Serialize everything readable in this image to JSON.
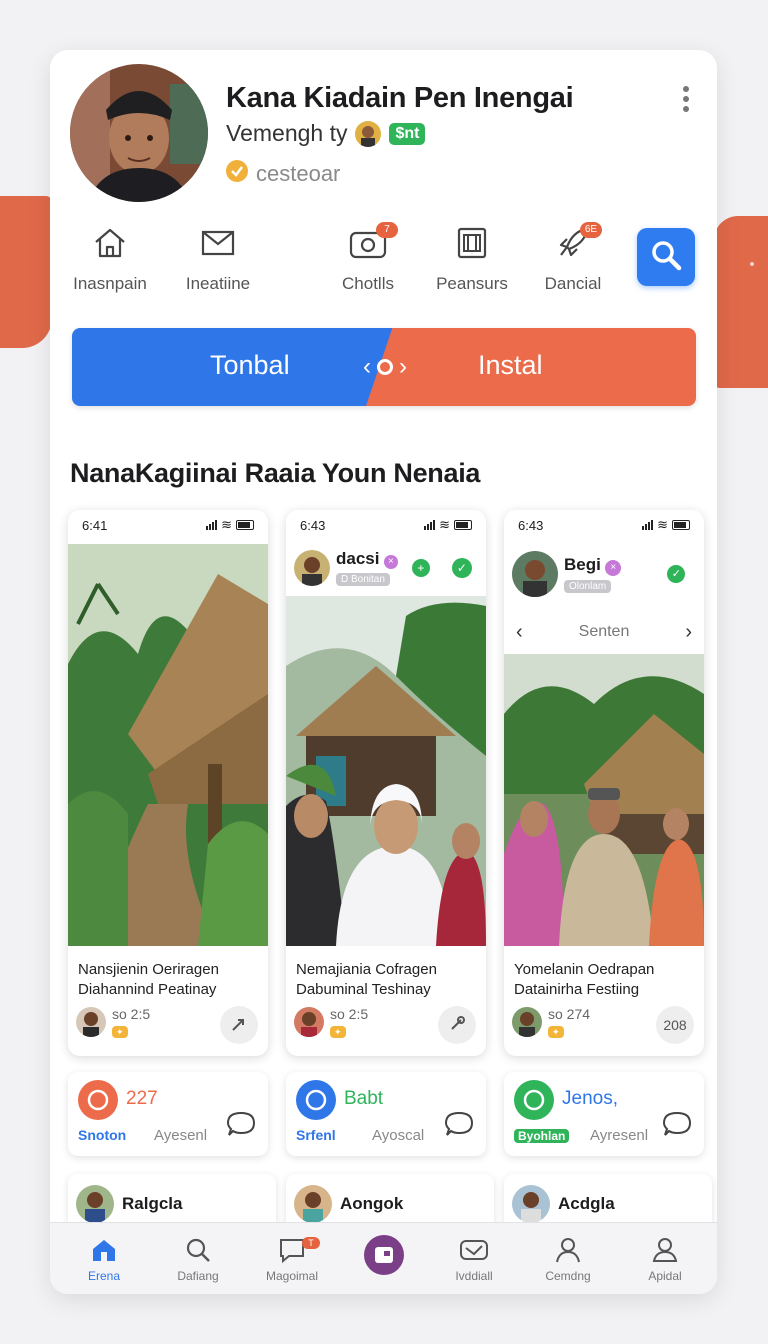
{
  "profile": {
    "name": "Kana Kiadain Pen Inengai",
    "subtitle": "Vemengh ty",
    "chip": "$nt",
    "verified_label": "cesteoar"
  },
  "actions": [
    {
      "label": "Inasnpain",
      "icon": "home-icon",
      "badge": ""
    },
    {
      "label": "Ineatiine",
      "icon": "mail-icon",
      "badge": ""
    },
    {
      "label": "Chotlls",
      "icon": "camera-icon",
      "badge": "7"
    },
    {
      "label": "Peansurs",
      "icon": "gallery-icon",
      "badge": ""
    },
    {
      "label": "Dancial",
      "icon": "rocket-icon",
      "badge": "6E"
    }
  ],
  "toggle": {
    "left_label": "Tonbal",
    "right_label": "Instal"
  },
  "section_title": "NanaKagiinai Raaia Youn Nenaia",
  "phones": [
    {
      "time": "6:41",
      "header_name": "",
      "header_sub": "",
      "nav_label": "",
      "title_lines": [
        "Nansjienin Oeriragen",
        "Diahannind Peatinay"
      ],
      "meta": "so 2:5",
      "action": ""
    },
    {
      "time": "6:43",
      "header_name": "dacsi",
      "header_sub": "D Bonitan",
      "nav_label": "",
      "title_lines": [
        "Nemajiania Cofragen",
        "Dabuminal Teshinay"
      ],
      "meta": "so 2:5",
      "action": ""
    },
    {
      "time": "6:43",
      "header_name": "Begi",
      "header_sub": "Olonlam",
      "nav_label": "Senten",
      "title_lines": [
        "Yomelanin Oedrapan",
        "Datainirha Festiing"
      ],
      "meta": "so 274",
      "action": "208"
    }
  ],
  "stats": [
    {
      "value": "227",
      "tag": "Snoton",
      "sub": "Ayesenl"
    },
    {
      "value": "Babt",
      "tag": "Srfenl",
      "sub": "Ayoscal"
    },
    {
      "value": "Jenos,",
      "tag": "Byohlan",
      "sub": "Ayresenl"
    }
  ],
  "minis": [
    {
      "name": "Ralgcla"
    },
    {
      "name": "Aongok"
    },
    {
      "name": "Acdgla"
    }
  ],
  "nav": [
    {
      "label": "Erena",
      "icon": "home-icon",
      "badge": ""
    },
    {
      "label": "Dafiang",
      "icon": "search-icon",
      "badge": ""
    },
    {
      "label": "Magoimal",
      "icon": "chat-icon",
      "badge": "T"
    },
    {
      "label": "",
      "icon": "create-icon",
      "badge": ""
    },
    {
      "label": "Ivddiall",
      "icon": "inbox-icon",
      "badge": ""
    },
    {
      "label": "Cemdng",
      "icon": "person-icon",
      "badge": ""
    },
    {
      "label": "Apidal",
      "icon": "profile-icon",
      "badge": ""
    }
  ],
  "colors": {
    "accent_blue": "#2f76e8",
    "accent_orange": "#ec6b4b",
    "green": "#2fb45a"
  }
}
